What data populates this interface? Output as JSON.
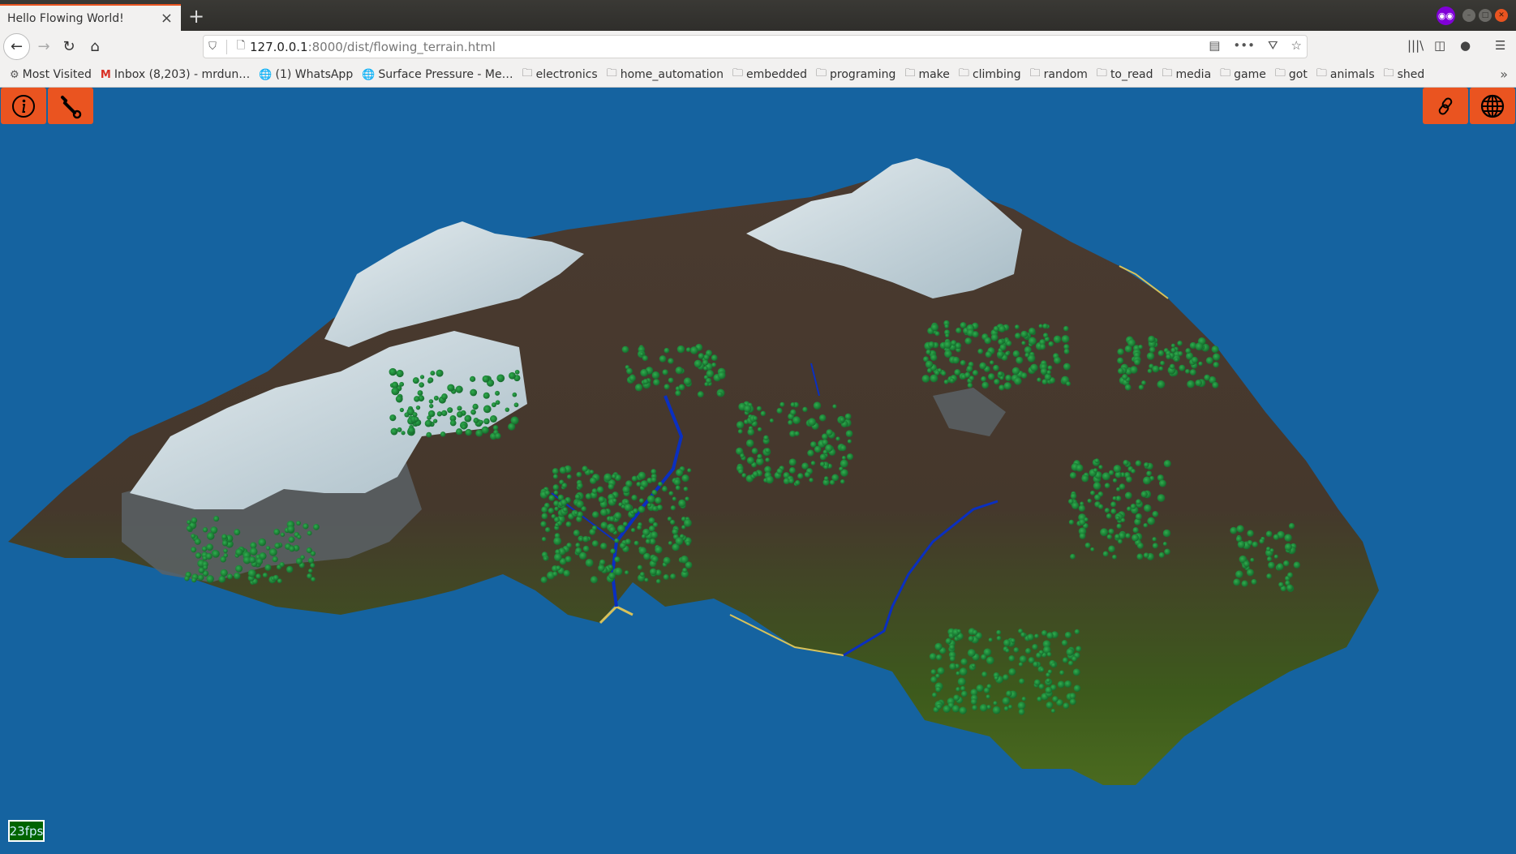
{
  "browser": {
    "tab_title": "Hello Flowing World!",
    "tab_close_icon": "×",
    "new_tab_icon": "+",
    "url_host": "127.0.0.1",
    "url_rest": ":8000/dist/flowing_terrain.html",
    "bookmarks": [
      {
        "icon": "gear-icon",
        "glyph": "⚙",
        "label": "Most Visited"
      },
      {
        "icon": "gmail-icon",
        "glyph": "M",
        "label": "Inbox (8,203) - mrdun…"
      },
      {
        "icon": "globe-icon",
        "glyph": "🌐",
        "label": "(1) WhatsApp"
      },
      {
        "icon": "globe-icon",
        "glyph": "🌐",
        "label": "Surface Pressure - Me…"
      },
      {
        "icon": "folder-icon",
        "glyph": "🗀",
        "label": "electronics"
      },
      {
        "icon": "folder-icon",
        "glyph": "🗀",
        "label": "home_automation"
      },
      {
        "icon": "folder-icon",
        "glyph": "🗀",
        "label": "embedded"
      },
      {
        "icon": "folder-icon",
        "glyph": "🗀",
        "label": "programing"
      },
      {
        "icon": "folder-icon",
        "glyph": "🗀",
        "label": "make"
      },
      {
        "icon": "folder-icon",
        "glyph": "🗀",
        "label": "climbing"
      },
      {
        "icon": "folder-icon",
        "glyph": "🗀",
        "label": "random"
      },
      {
        "icon": "folder-icon",
        "glyph": "🗀",
        "label": "to_read"
      },
      {
        "icon": "folder-icon",
        "glyph": "🗀",
        "label": "media"
      },
      {
        "icon": "folder-icon",
        "glyph": "🗀",
        "label": "game"
      },
      {
        "icon": "folder-icon",
        "glyph": "🗀",
        "label": "got"
      },
      {
        "icon": "folder-icon",
        "glyph": "🗀",
        "label": "animals"
      },
      {
        "icon": "folder-icon",
        "glyph": "🗀",
        "label": "shed"
      }
    ]
  },
  "app": {
    "buttons_left": [
      {
        "name": "info-button",
        "icon": "info-icon"
      },
      {
        "name": "settings-button",
        "icon": "wrench-icon"
      }
    ],
    "buttons_right": [
      {
        "name": "link-button",
        "icon": "link-icon"
      },
      {
        "name": "globe-button",
        "icon": "globe-icon"
      }
    ],
    "fps": "23fps",
    "colors": {
      "accent": "#ea5420",
      "water": "#1563a0",
      "snow": "#c6d6dd",
      "rock": "#4a3a30",
      "grass": "#3d5a1c",
      "trees": "#1f8a3a",
      "river": "#0a2fc0",
      "sand": "#d8c25a",
      "fps_bg": "#006400"
    }
  }
}
